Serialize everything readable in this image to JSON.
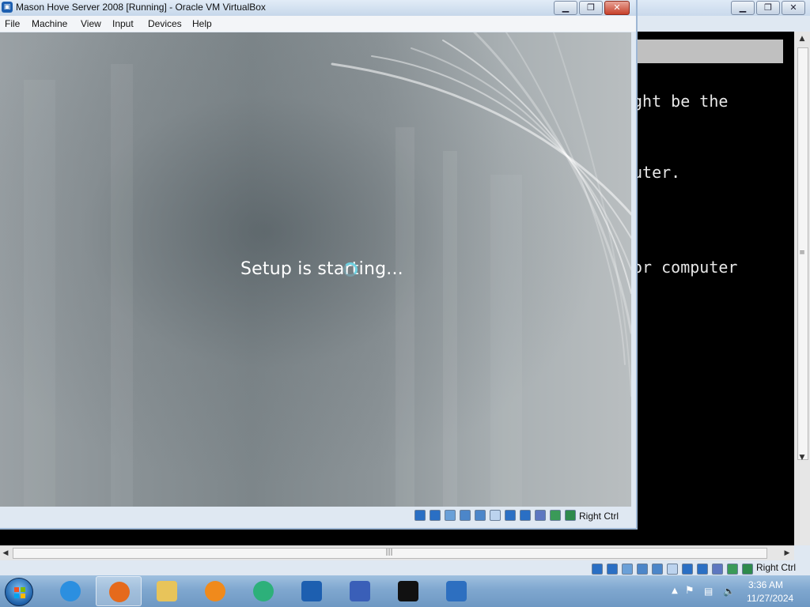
{
  "vm_window": {
    "title": "Mason Hove Server 2008 [Running] - Oracle VM VirtualBox",
    "menu": [
      "File",
      "Machine",
      "View",
      "Input",
      "Devices",
      "Help"
    ],
    "host_key_label": "Right Ctrl"
  },
  "guest_screen": {
    "status_text": "Setup is starting..."
  },
  "background_window": {
    "console_lines": [
      "ght be the",
      "uter.",
      "or computer"
    ],
    "host_key_label": "Right Ctrl"
  },
  "taskbar": {
    "items": [
      "internet-explorer",
      "firefox",
      "file-explorer",
      "media-player",
      "app-green-arrow",
      "virtualbox",
      "network-tool",
      "7zip",
      "windows-server-2008"
    ],
    "active_item": "firefox",
    "time": "3:36 AM",
    "date": "11/27/2024"
  },
  "status_icons": [
    "hard-disk",
    "optical-drive",
    "audio",
    "network",
    "usb",
    "shared-folders",
    "display",
    "video-capture",
    "cpu",
    "mouse-integration",
    "keyboard"
  ]
}
